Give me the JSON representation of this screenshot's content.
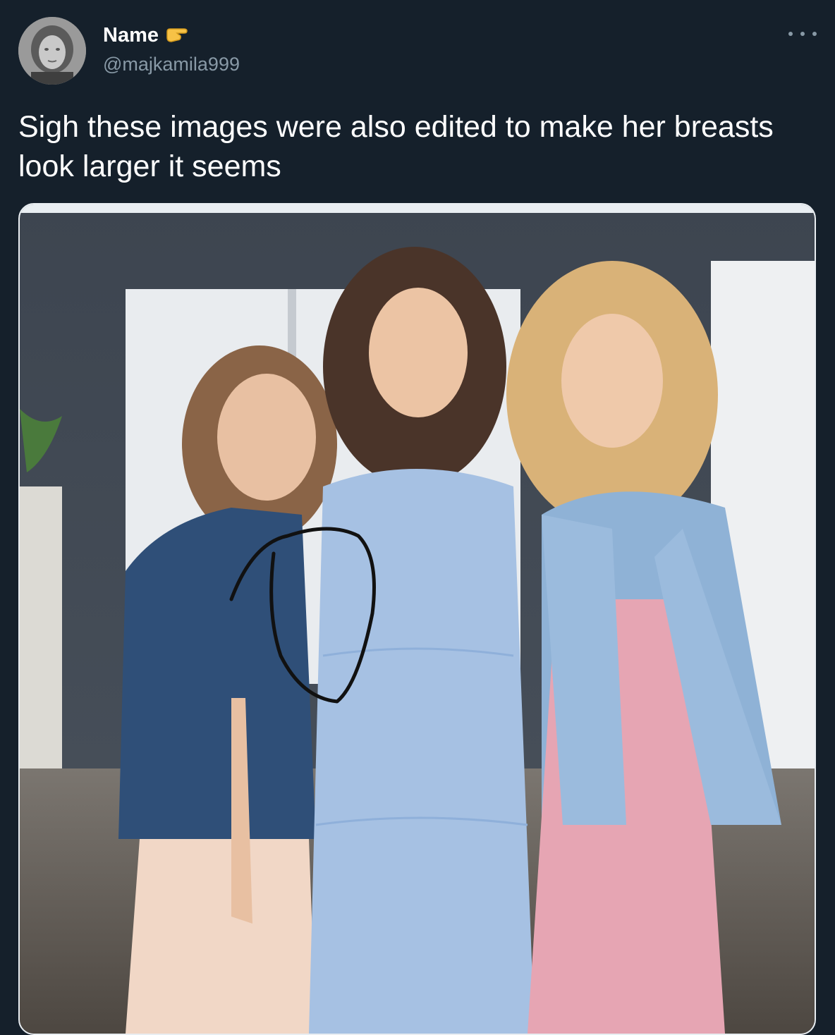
{
  "tweet": {
    "author": {
      "display_name": "Name",
      "name_emoji": "backhand-pointing-right-emoji",
      "handle": "@majkamila999",
      "avatar_icon": "grayscale-portrait-avatar"
    },
    "more_icon": "more-options-icon",
    "text": "Sigh these images were also edited to make her breasts look larger it seems",
    "media": {
      "kind": "photo",
      "annotation_icon": "hand-drawn-circle-mark"
    }
  },
  "colors": {
    "background": "#15202b",
    "text_primary": "#ffffff",
    "text_secondary": "#8899a6"
  }
}
